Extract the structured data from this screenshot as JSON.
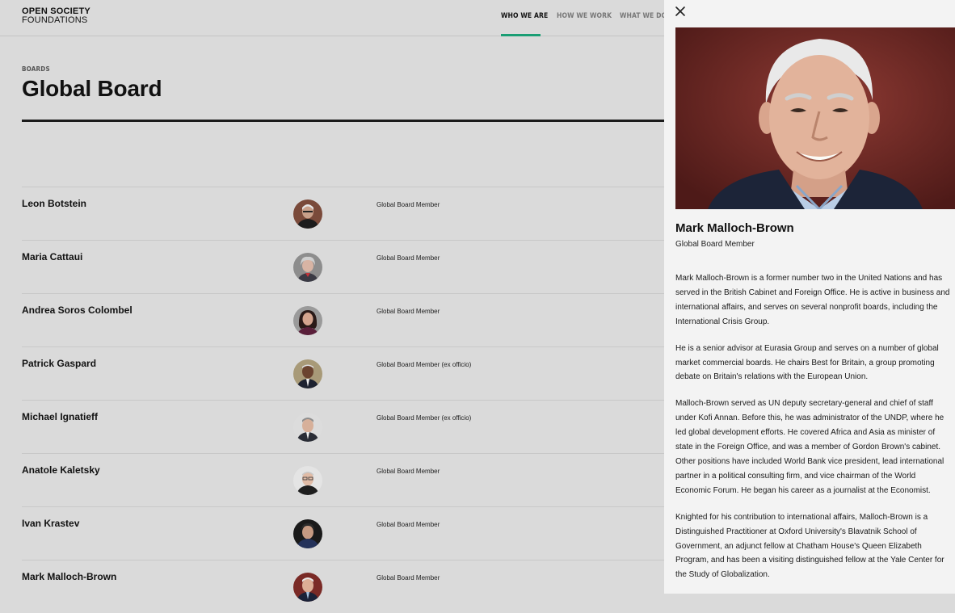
{
  "header": {
    "logo_line1": "OPEN SOCIETY",
    "logo_line2": "FOUNDATIONS",
    "nav": [
      {
        "label": "WHO WE ARE",
        "active": true
      },
      {
        "label": "HOW WE WORK",
        "active": false
      },
      {
        "label": "WHAT WE DO",
        "active": false
      }
    ]
  },
  "page": {
    "eyebrow": "BOARDS",
    "title": "Global Board"
  },
  "members": [
    {
      "name": "Leon Botstein",
      "role": "Global Board Member"
    },
    {
      "name": "Maria Cattaui",
      "role": "Global Board Member"
    },
    {
      "name": "Andrea Soros Colombel",
      "role": "Global Board Member"
    },
    {
      "name": "Patrick Gaspard",
      "role": "Global Board Member (ex officio)"
    },
    {
      "name": "Michael Ignatieff",
      "role": "Global Board Member (ex officio)"
    },
    {
      "name": "Anatole Kaletsky",
      "role": "Global Board Member"
    },
    {
      "name": "Ivan Krastev",
      "role": "Global Board Member"
    },
    {
      "name": "Mark Malloch-Brown",
      "role": "Global Board Member"
    }
  ],
  "panel": {
    "close_icon": "close-icon",
    "name": "Mark Malloch-Brown",
    "role": "Global Board Member",
    "bio": [
      "Mark Malloch-Brown is a former number two in the United Nations and has\nserved in the British Cabinet and Foreign Office. He is active in business and\ninternational affairs, and serves on several nonprofit boards, including the\nInternational Crisis Group.",
      "He is a senior advisor at Eurasia Group and serves on a number of global\nmarket commercial boards. He chairs Best for Britain, a group promoting\ndebate on Britain's relations with the European Union.",
      "Malloch-Brown served as UN deputy secretary-general and chief of staff\nunder Kofi Annan. Before this, he was administrator of the UNDP, where he\nled global development efforts. He covered Africa and Asia as minister of\nstate in the Foreign Office, and was a member of Gordon Brown's cabinet.\nOther positions have included World Bank vice president, lead international\npartner in a political consulting firm, and vice chairman of the World\nEconomic Forum. He began his career as a journalist at the Economist.",
      "Knighted for his contribution to international affairs, Malloch-Brown is a\nDistinguished Practitioner at Oxford University's Blavatnik School of\nGovernment, an adjunct fellow at Chatham House's Queen Elizabeth\nProgram, and has been a visiting distinguished fellow at the Yale Center for\nthe Study of Globalization."
    ]
  },
  "colors": {
    "accent": "#1a9e74",
    "overlay_bg": "#dadada",
    "panel_bg": "#f3f3f3"
  }
}
